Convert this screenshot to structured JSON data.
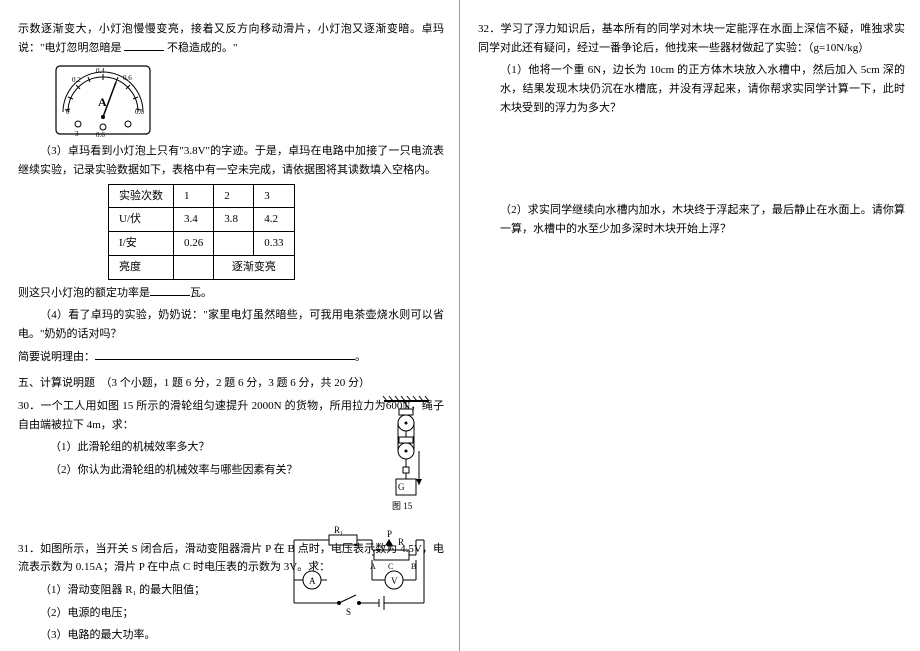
{
  "left": {
    "intro_line": "示数逐渐变大，小灯泡慢慢变亮，接着又反方向移动滑片，小灯泡又逐渐变暗。卓玛说：\"电灯忽明忽暗是",
    "intro_end": "不稳造成的。\"",
    "q3_text": "（3）卓玛看到小灯泡上只有\"3.8V\"的字迹。于是，卓玛在电路中加接了一只电流表继续实验，记录实验数据如下，表格中有一空未完成，请依据图将其读数填入空格内。",
    "table": {
      "headers": [
        "实验次数",
        "1",
        "2",
        "3"
      ],
      "row_u": [
        "U/伏",
        "3.4",
        "3.8",
        "4.2"
      ],
      "row_i": [
        "I/安",
        "0.26",
        "",
        "0.33"
      ],
      "row_b": [
        "亮度",
        "",
        "逐渐变亮"
      ]
    },
    "rated_power_pre": "则这只小灯泡的额定功率是",
    "rated_power_post": "瓦。",
    "q4_text": "（4）看了卓玛的实验，奶奶说：\"家里电灯虽然暗些，可我用电茶壶烧水则可以省电。\"奶奶的话对吗？",
    "reason_label": "简要说明理由：",
    "section5_head": "五、计算说明题　（3 个小题，1 题 6 分，2 题 6 分，3 题 6 分，共 20 分）",
    "q30_num": "30．",
    "q30_text": "一个工人用如图 15 所示的滑轮组匀速提升 2000N 的货物，所用拉力为600N，绳子自由端被拉下 4m，求：",
    "q30_1": "（1）此滑轮组的机械效率多大？",
    "q30_2": "（2）你认为此滑轮组的机械效率与哪些因素有关？",
    "fig15_label": "图 15",
    "q31_num": "31．",
    "q31_text": "如图所示，当开关 S 闭合后，滑动变阻器滑片 P 在 B 点时，电压表示数为 4.5V，电流表示数为 0.15A；滑片 P 在中点 C 时电压表的示数为 3V。求：",
    "q31_1": "（1）滑动变阻器 R₁ 的最大阻值；",
    "q31_2": "（2）电源的电压；",
    "q31_3": "（3）电路的最大功率。",
    "circuit_labels": {
      "r1": "R₁",
      "p": "P",
      "r": "R",
      "a": "A",
      "c": "C",
      "b": "B",
      "s": "S",
      "am": "A",
      "vm": "V"
    }
  },
  "right": {
    "q32_num": "32．",
    "q32_intro": "学习了浮力知识后，基本所有的同学对木块一定能浮在水面上深信不疑，唯独求实同学对此还有疑问，经过一番争论后，他找来一些器材做起了实验：（g=10N/kg）",
    "q32_1": "（1）他将一个重 6N，边长为 10cm 的正方体木块放入水槽中，然后加入 5cm 深的水，结果发现木块仍沉在水槽底，并没有浮起来，请你帮求实同学计算一下，此时木块受到的浮力为多大？",
    "q32_2": "（2）求实同学继续向水槽内加水，木块终于浮起来了，最后静止在水面上。请你算一算，水槽中的水至少加多深时木块开始上浮？"
  }
}
